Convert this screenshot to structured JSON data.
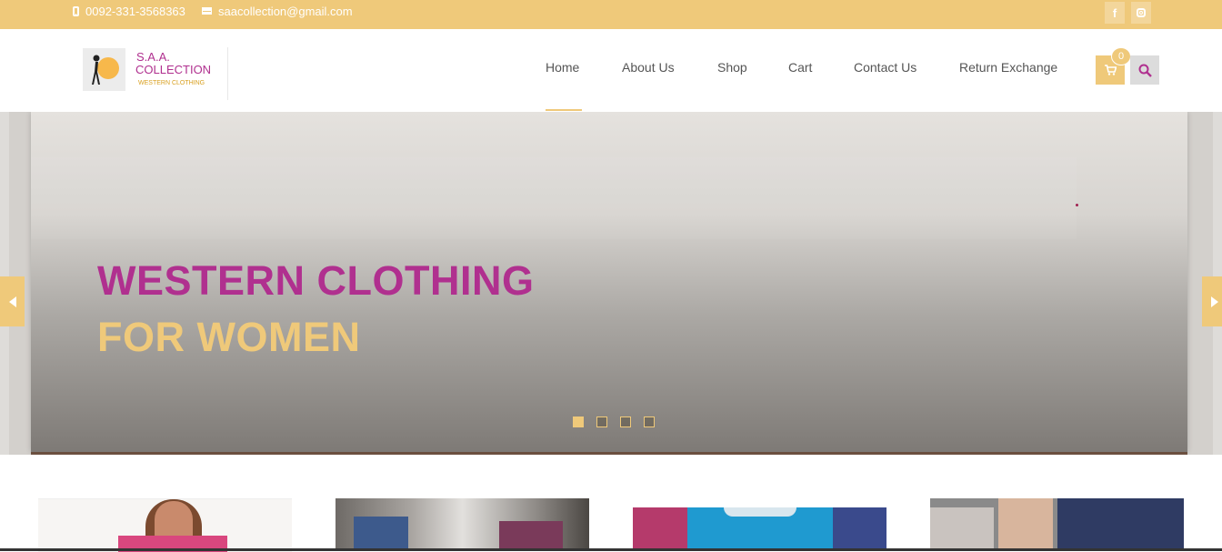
{
  "topbar": {
    "phone": "0092-331-3568363",
    "email": "saacollection@gmail.com",
    "social": [
      "facebook-icon",
      "instagram-icon"
    ]
  },
  "logo": {
    "line1": "S.A.A.",
    "line2": "COLLECTION",
    "line3": "WESTERN CLOTHING"
  },
  "nav": {
    "items": [
      {
        "label": "Home",
        "active": true
      },
      {
        "label": "About Us"
      },
      {
        "label": "Shop"
      },
      {
        "label": "Cart"
      },
      {
        "label": "Contact Us"
      },
      {
        "label": "Return Exchange"
      }
    ],
    "cart_count": "0"
  },
  "slider": {
    "headline_line1": "WESTERN CLOTHING",
    "headline_line2": "FOR WOMEN",
    "slide_count": 4,
    "active_slide": 1
  },
  "colors": {
    "accent": "#efc97a",
    "brand": "#b0308f"
  }
}
